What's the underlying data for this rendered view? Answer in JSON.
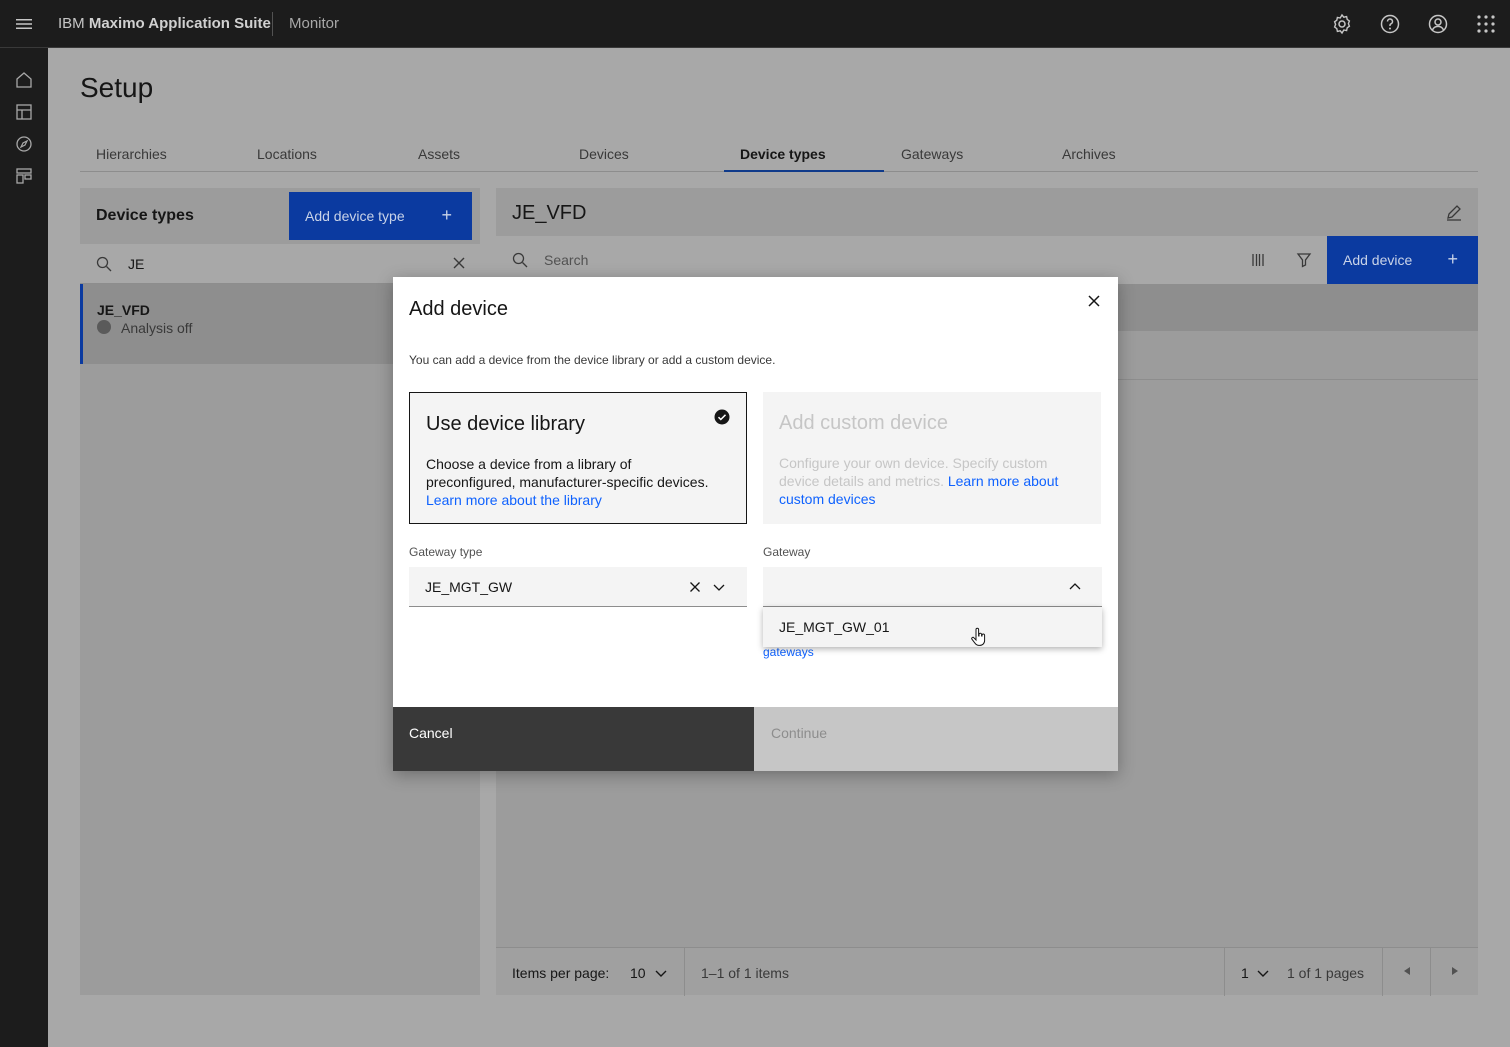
{
  "header": {
    "brand_prefix": "IBM",
    "brand_name": "Maximo Application Suite",
    "product": "Monitor",
    "icons": [
      "settings-icon",
      "help-icon",
      "user-icon",
      "app-switcher-icon"
    ]
  },
  "rail": {
    "icons": [
      "home-icon",
      "dashboard-icon",
      "explore-icon",
      "setup-icon"
    ]
  },
  "page": {
    "title": "Setup",
    "tabs": [
      {
        "label": "Hierarchies"
      },
      {
        "label": "Locations"
      },
      {
        "label": "Assets"
      },
      {
        "label": "Devices"
      },
      {
        "label": "Device types"
      },
      {
        "label": "Gateways"
      },
      {
        "label": "Archives"
      }
    ],
    "active_tab": "Device types"
  },
  "left_panel": {
    "title": "Device types",
    "add_button": "Add device type",
    "search_value": "JE",
    "items": [
      {
        "name": "JE_VFD",
        "status": "Analysis off"
      }
    ]
  },
  "right_panel": {
    "title": "JE_VFD",
    "search_placeholder": "Search",
    "add_button": "Add device",
    "pager": {
      "items_per_page_label": "Items per page:",
      "items_per_page": "10",
      "range": "1–1 of 1 items",
      "page": "1",
      "page_of": "1 of 1 pages"
    }
  },
  "modal": {
    "title": "Add device",
    "description": "You can add a device from the device library or add a custom device.",
    "tile_library": {
      "heading": "Use device library",
      "body": "Choose a device from a library of preconfigured, manufacturer-specific devices.",
      "link": "Learn more about the library"
    },
    "tile_custom": {
      "heading": "Add custom device",
      "body": "Configure your own device. Specify custom device details and metrics.",
      "link": "Learn more about custom devices"
    },
    "gateway_type_label": "Gateway type",
    "gateway_type_value": "JE_MGT_GW",
    "gateway_label": "Gateway",
    "gateway_value": "",
    "gateway_options": [
      "JE_MGT_GW_01"
    ],
    "helper_link": "gateways",
    "cancel": "Cancel",
    "continue": "Continue"
  },
  "colors": {
    "primary": "#0f62fe",
    "header_bg": "#161616",
    "overlay": "#a8a8a8"
  }
}
